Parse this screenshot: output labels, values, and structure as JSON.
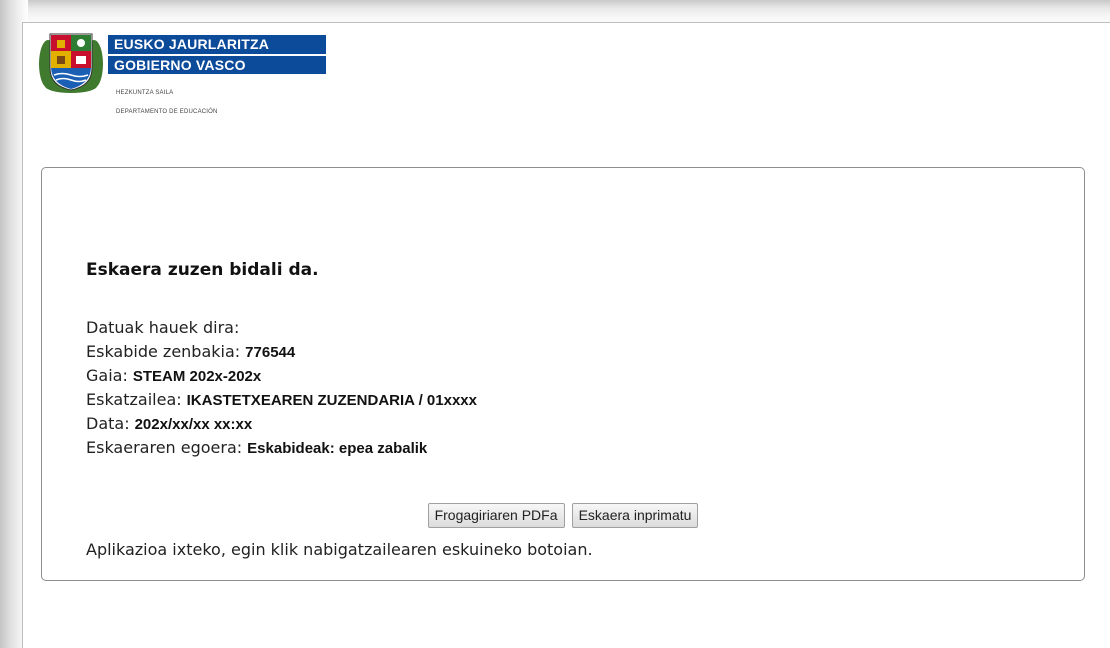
{
  "header": {
    "org_line1": "EUSKO JAURLARITZA",
    "org_line2": "GOBIERNO VASCO",
    "dept_line1": "HEZKUNTZA SAILA",
    "dept_line2": "DEPARTAMENTO DE EDUCACIÓN",
    "logo_icon": "basque-government-shield-icon"
  },
  "main": {
    "title": "Eskaera zuzen bidali da.",
    "intro": "Datuak hauek dira:",
    "fields": [
      {
        "label": "Eskabide zenbakia:",
        "value": "776544"
      },
      {
        "label": "Gaia:",
        "value": "STEAM 202x-202x"
      },
      {
        "label": "Eskatzailea:",
        "value": "IKASTETXEAREN ZUZENDARIA / 01xxxx"
      },
      {
        "label": "Data:",
        "value": "202x/xx/xx xx:xx"
      },
      {
        "label": "Eskaeraren egoera:",
        "value": "Eskabideak: epea zabalik"
      }
    ],
    "buttons": {
      "pdf_label": "Frogagiriaren PDFa",
      "print_label": "Eskaera inprimatu"
    },
    "footer": "Aplikazioa ixteko, egin klik nabigatzailearen eskuineko botoian."
  },
  "colors": {
    "brand_band": "#0c4a9a",
    "panel_border": "#8e8e8e"
  }
}
